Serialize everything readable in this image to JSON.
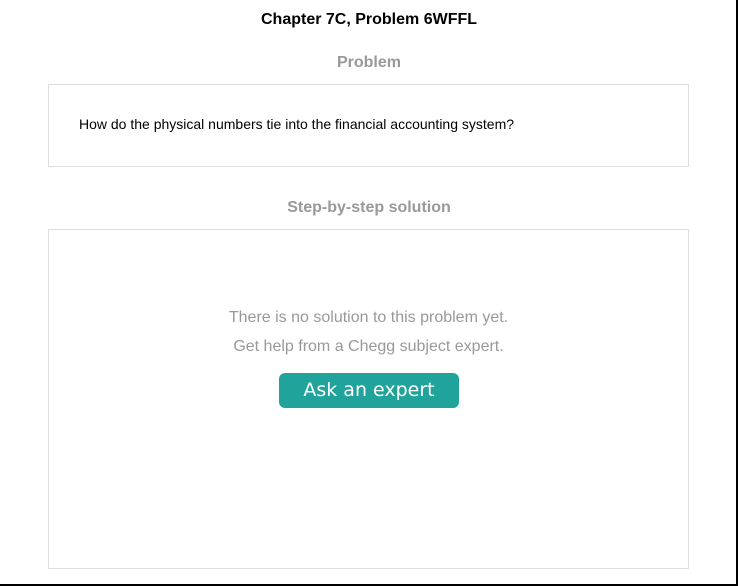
{
  "page": {
    "title": "Chapter 7C, Problem 6WFFL"
  },
  "problem": {
    "heading": "Problem",
    "text": "How do the physical numbers tie into the financial accounting system?"
  },
  "solution": {
    "heading": "Step-by-step solution",
    "empty_message_line1": "There is no solution to this problem yet.",
    "empty_message_line2": "Get help from a Chegg subject expert.",
    "ask_button_label": "Ask an expert"
  },
  "colors": {
    "accent": "#1fa39a",
    "muted_text": "#999999",
    "box_border": "#dddddd"
  }
}
